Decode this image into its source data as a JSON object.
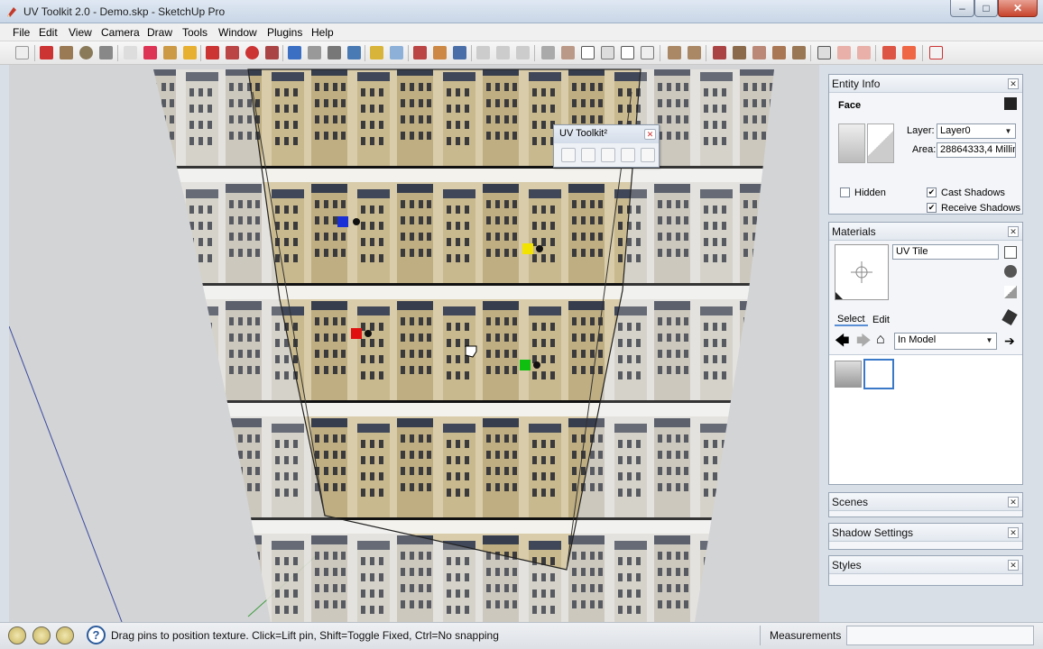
{
  "window": {
    "title": "UV Toolkit 2.0 - Demo.skp - SketchUp Pro",
    "min_glyph": "–",
    "max_glyph": "□",
    "close_glyph": "✕"
  },
  "menu": {
    "items": [
      "File",
      "Edit",
      "View",
      "Camera",
      "Draw",
      "Tools",
      "Window",
      "Plugins",
      "Help"
    ]
  },
  "uv_toolkit": {
    "title": "UV Toolkit²",
    "close_glyph": "✕"
  },
  "entity_info": {
    "title": "Entity Info",
    "close_glyph": "✕",
    "type": "Face",
    "layer_label": "Layer:",
    "layer_value": "Layer0",
    "area_label": "Area:",
    "area_value": "28864333,4 Millim",
    "hidden_label": "Hidden",
    "hidden_checked": false,
    "cast_shadows_label": "Cast Shadows",
    "cast_shadows_checked": true,
    "receive_shadows_label": "Receive Shadows",
    "receive_shadows_checked": true
  },
  "materials": {
    "title": "Materials",
    "close_glyph": "✕",
    "material_name": "UV Tile",
    "tab_select": "Select",
    "tab_edit": "Edit",
    "library": "In Model"
  },
  "scenes": {
    "title": "Scenes",
    "close_glyph": "✕"
  },
  "shadow_settings": {
    "title": "Shadow Settings",
    "close_glyph": "✕"
  },
  "styles": {
    "title": "Styles",
    "close_glyph": "✕"
  },
  "status": {
    "help_glyph": "?",
    "message": "Drag pins to position texture.  Click=Lift pin, Shift=Toggle Fixed, Ctrl=No snapping",
    "measurements_label": "Measurements"
  },
  "colors": {
    "pin_blue": "#1a2fd6",
    "pin_yellow": "#f2e400",
    "pin_red": "#e01010",
    "pin_green": "#10c010"
  }
}
